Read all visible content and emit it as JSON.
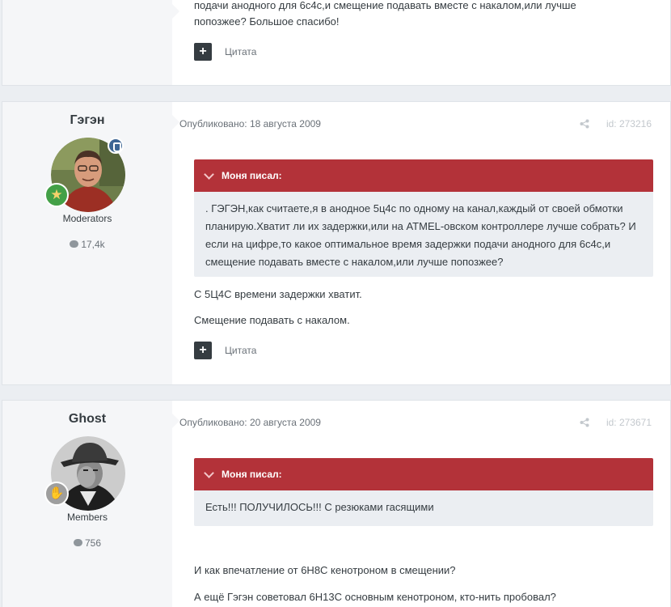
{
  "posts": [
    {
      "body_lines": [
        "подачи анодного для 6с4с,и смещение подавать вместе с накалом,или лучше",
        "попозжее? Большое спасибо!"
      ],
      "quote_label": "Цитата"
    },
    {
      "author": "Гэгэн",
      "group": "Moderators",
      "post_count": "17,4k",
      "published": "Опубликовано: 18 августа 2009",
      "post_id": "id: 273216",
      "quote_header": "Моня писал:",
      "quote_text": ". ГЭГЭН,как считаете,я в анодное 5ц4с по одному на канал,каждый от своей обмотки планирую.Хватит ли их задержки,или на ATMEL-овском контроллере лучше собрать? И если на цифре,то какое оптимальное время задержки подачи анодного для 6с4с,и смещение подавать вместе с накалом,или лучше попозжее?",
      "paragraphs": [
        "С 5Ц4С времени задержки хватит.",
        "Смещение подавать с накалом."
      ],
      "quote_label": "Цитата"
    },
    {
      "author": "Ghost",
      "group": "Members",
      "post_count": "756",
      "published": "Опубликовано: 20 августа 2009",
      "post_id": "id: 273671",
      "quote_header": "Моня писал:",
      "quote_text": "Есть!!! ПОЛУЧИЛОСЬ!!! С резюками гасящими",
      "paragraphs": [
        "И как впечатление от 6Н8С кенотроном в смещении?",
        "А ещё Гэгэн советовал 6Н13С основным кенотроном, кто-нить пробовал?"
      ]
    }
  ]
}
